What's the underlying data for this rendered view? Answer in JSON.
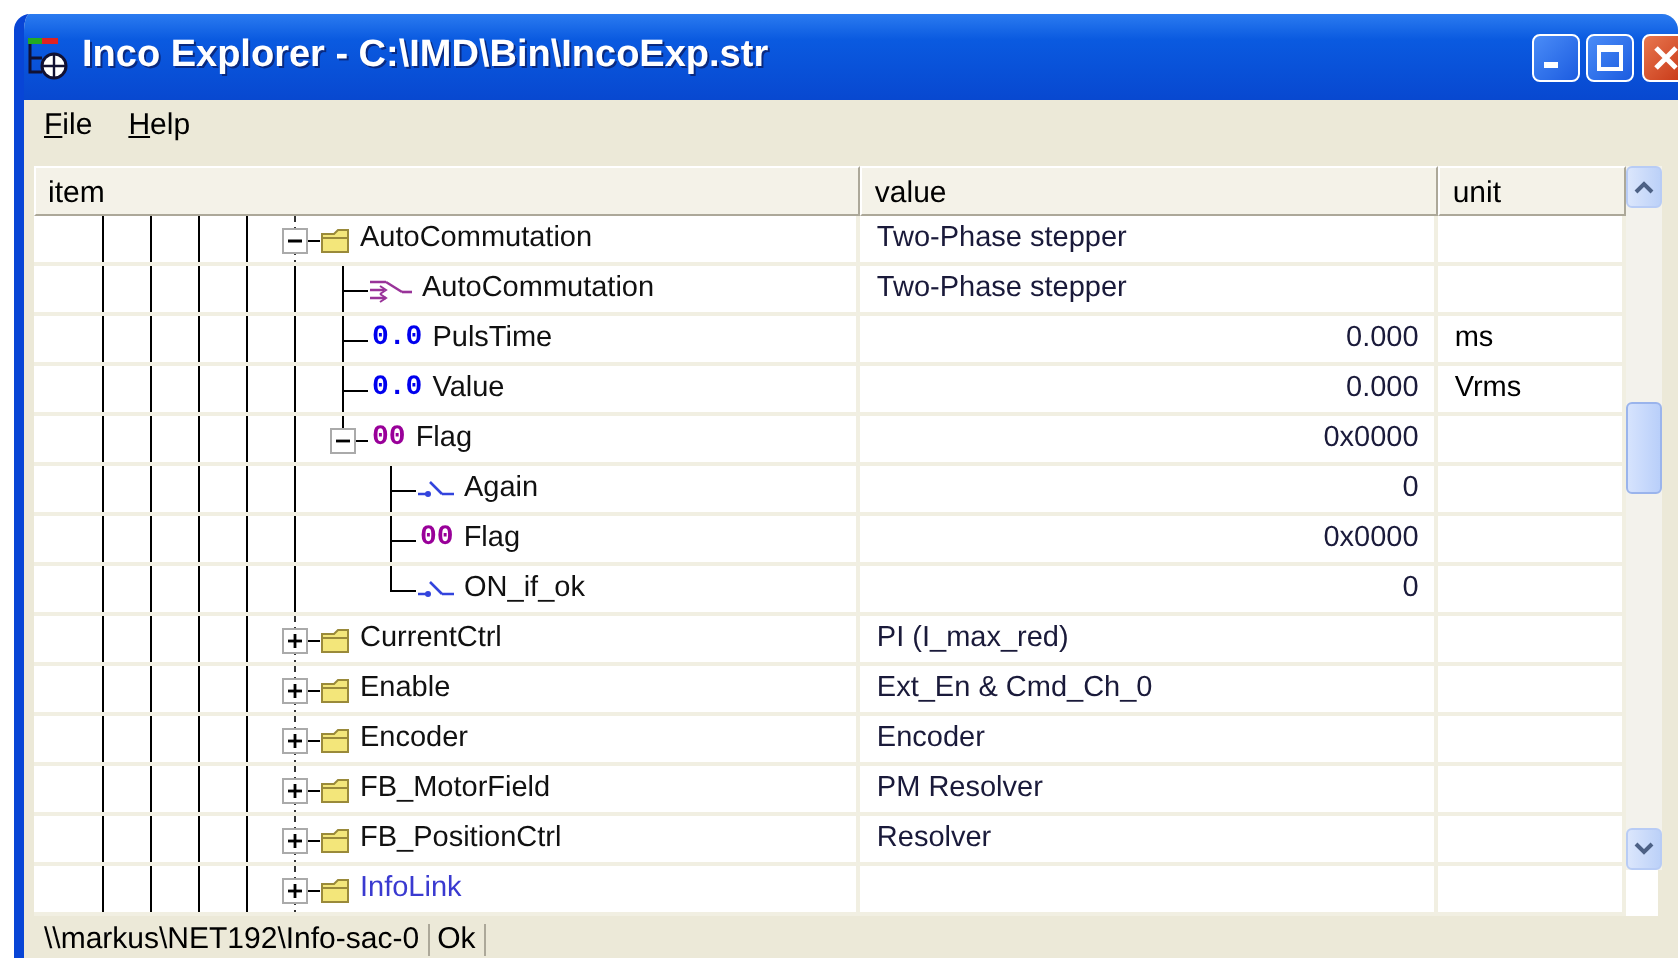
{
  "window": {
    "title": "Inco Explorer - C:\\IMD\\Bin\\IncoExp.str"
  },
  "menu": [
    "File",
    "Help"
  ],
  "columns": [
    "item",
    "value",
    "unit"
  ],
  "tree": [
    {
      "kind": "folder",
      "label": "AutoCommutation",
      "value": "Two-Phase stepper",
      "expanded": true,
      "linked": false,
      "children": [
        {
          "kind": "enum",
          "label": "AutoCommutation",
          "value": "Two-Phase stepper",
          "linked": false
        },
        {
          "kind": "float",
          "prefix": "0.0",
          "label": "PulsTime",
          "value": "0.000",
          "unit": "ms",
          "linked": false
        },
        {
          "kind": "float",
          "prefix": "0.0",
          "label": "Value",
          "value": "0.000",
          "unit": "Vrms",
          "linked": false
        },
        {
          "kind": "hex",
          "prefix": "00",
          "label": "Flag",
          "value": "0x0000",
          "expanded": true,
          "linked": false,
          "children": [
            {
              "kind": "bit",
              "label": "Again",
              "value": "0",
              "linked": false
            },
            {
              "kind": "hex",
              "prefix": "00",
              "label": "Flag",
              "value": "0x0000",
              "linked": false
            },
            {
              "kind": "bit",
              "label": "ON_if_ok",
              "value": "0",
              "linked": false
            }
          ]
        }
      ]
    },
    {
      "kind": "folder",
      "label": "CurrentCtrl",
      "value": "PI (I_max_red)",
      "expanded": false,
      "linked": false
    },
    {
      "kind": "folder",
      "label": "Enable",
      "value": "Ext_En & Cmd_Ch_0",
      "expanded": false,
      "linked": false
    },
    {
      "kind": "folder",
      "label": "Encoder",
      "value": "Encoder",
      "expanded": false,
      "linked": false
    },
    {
      "kind": "folder",
      "label": "FB_MotorField",
      "value": "PM Resolver",
      "expanded": false,
      "linked": false
    },
    {
      "kind": "folder",
      "label": "FB_PositionCtrl",
      "value": "Resolver",
      "expanded": false,
      "linked": false
    },
    {
      "kind": "folder",
      "label": "InfoLink",
      "expanded": false,
      "linked": true
    }
  ],
  "status_bar": [
    "\\\\markus\\NET192\\Info-sac-0",
    "Ok"
  ]
}
